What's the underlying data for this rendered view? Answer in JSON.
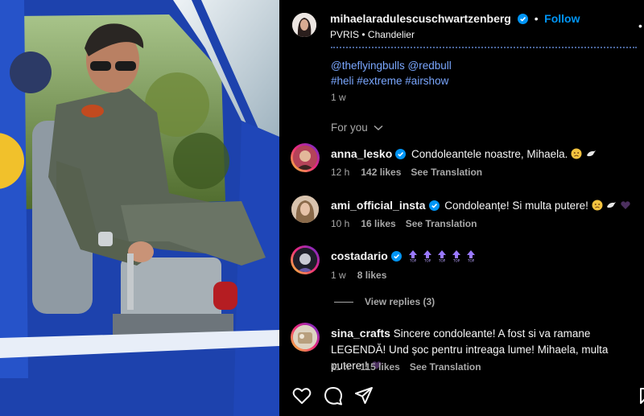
{
  "post": {
    "author": "mihaelaradulescuschwartzenberg",
    "follow_label": "Follow",
    "separator": "•",
    "audio": "PVRIS",
    "audio_track": "Chandelier",
    "caption_mentions": "@theflyingbulls @redbull",
    "caption_tags": "#heli #extreme #airshow",
    "caption_age": "1 w"
  },
  "comments_section": {
    "for_you_label": "For you"
  },
  "comments": [
    {
      "user": "anna_lesko",
      "text": "Condoleantele noastre, Mihaela.",
      "age": "12 h",
      "likes": "142 likes",
      "translate": "See Translation"
    },
    {
      "user": "ami_official_insta",
      "text": "Condoleanțe! Si multa putere!",
      "age": "10 h",
      "likes": "16 likes",
      "translate": "See Translation"
    },
    {
      "user": "costadario",
      "text": "",
      "age": "1 w",
      "likes": "8 likes",
      "view_replies": "View replies (3)"
    },
    {
      "user": "sina_crafts",
      "text": "Sincere condoleante! A fost si va ramane LEGENDĂ! Und șoc pentru intreaga lume! Mihaela, multa putere !",
      "age": "11 h",
      "likes": "115 likes",
      "translate": "See Translation"
    }
  ],
  "actions": {
    "icons": [
      "heart-icon",
      "comment-icon",
      "share-icon",
      "bookmark-icon"
    ]
  },
  "colors": {
    "background": "#000000",
    "link": "#0095f6",
    "verified": "#0095f6",
    "muted": "#a8a8a8"
  }
}
